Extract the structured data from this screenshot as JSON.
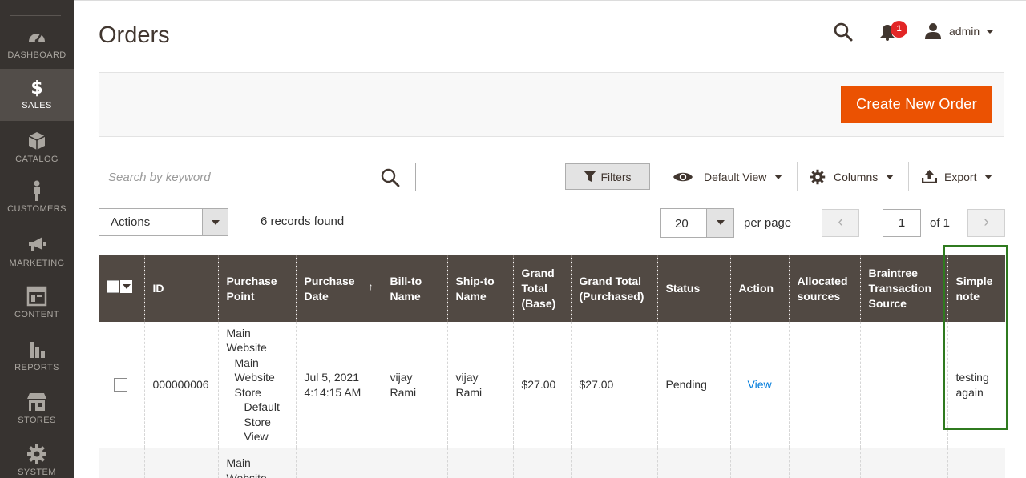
{
  "sidebar": {
    "items": [
      {
        "label": "DASHBOARD",
        "icon": "dashboard-icon"
      },
      {
        "label": "SALES",
        "icon": "dollar-icon"
      },
      {
        "label": "CATALOG",
        "icon": "cube-icon"
      },
      {
        "label": "CUSTOMERS",
        "icon": "person-icon"
      },
      {
        "label": "MARKETING",
        "icon": "megaphone-icon"
      },
      {
        "label": "CONTENT",
        "icon": "layout-icon"
      },
      {
        "label": "REPORTS",
        "icon": "bar-chart-icon"
      },
      {
        "label": "STORES",
        "icon": "store-icon"
      },
      {
        "label": "SYSTEM",
        "icon": "gear-icon"
      }
    ],
    "active": "SALES"
  },
  "header": {
    "title": "Orders",
    "notification_count": "1",
    "user": "admin"
  },
  "actions_bar": {
    "create_label": "Create New Order",
    "accent_color": "#eb5202"
  },
  "toolbar": {
    "search_placeholder": "Search by keyword",
    "filters_label": "Filters",
    "view_label": "Default View",
    "columns_label": "Columns",
    "export_label": "Export",
    "actions_label": "Actions",
    "records_found": "6 records found",
    "per_page_value": "20",
    "per_page_label": "per page",
    "page_value": "1",
    "page_of": "of 1"
  },
  "grid": {
    "headers": {
      "id": "ID",
      "purchase_point": "Purchase Point",
      "purchase_date": "Purchase Date",
      "bill_to": "Bill-to Name",
      "ship_to": "Ship-to Name",
      "grand_total_base": "Grand Total (Base)",
      "grand_total_purchased": "Grand Total (Purchased)",
      "status": "Status",
      "action": "Action",
      "allocated_sources": "Allocated sources",
      "braintree_source": "Braintree Transaction Source",
      "simple_note": "Simple note"
    },
    "sort_indicator": "↑",
    "rows": [
      {
        "id": "000000006",
        "purchase_point_1": "Main Website",
        "purchase_point_2": "Main Website Store",
        "purchase_point_3": "Default Store View",
        "purchase_date": "Jul 5, 2021 4:14:15 AM",
        "bill_to": "vijay Rami",
        "ship_to": "vijay Rami",
        "grand_total_base": "$27.00",
        "grand_total_purchased": "$27.00",
        "status": "Pending",
        "action": "View",
        "allocated_sources": "",
        "braintree_source": "",
        "simple_note": "testing again"
      },
      {
        "purchase_point_1": "Main Website"
      }
    ]
  }
}
